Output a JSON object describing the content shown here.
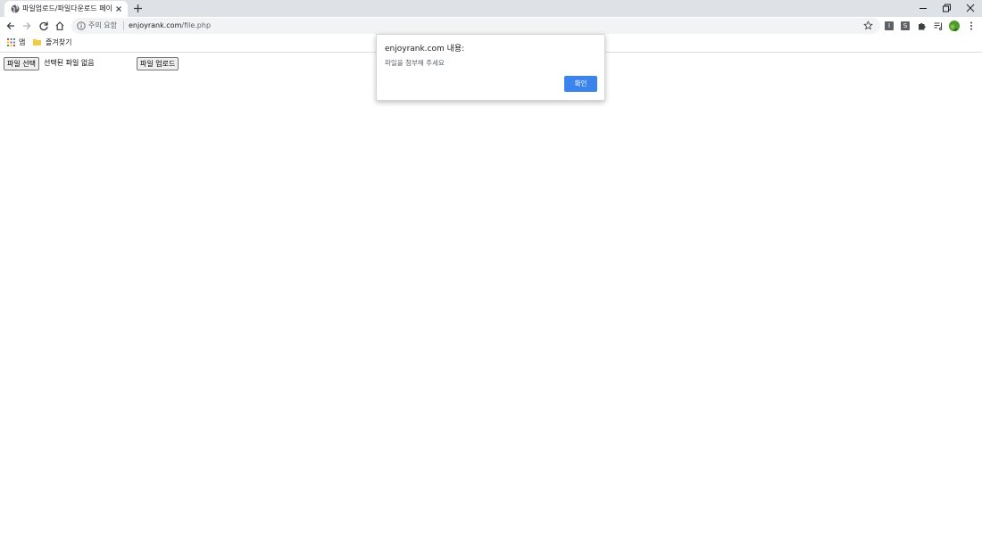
{
  "browser": {
    "tab": {
      "title": "파일업로드/파일다운로드 페이지"
    },
    "omnibox": {
      "security_label": "주의 요함",
      "url_host": "enjoyrank.com",
      "url_path": "/file.php"
    },
    "extensions": [
      {
        "label": "I"
      },
      {
        "label": "S"
      }
    ],
    "bookmarks": {
      "apps_label": "앱",
      "folder_label": "즐겨찾기"
    }
  },
  "page": {
    "file_input": {
      "button_label": "파일 선택",
      "status_text": "선택된 파일 없음"
    },
    "upload_button_label": "파일 업로드"
  },
  "dialog": {
    "title": "enjoyrank.com 내용:",
    "message": "파일을 첨부해 주세요",
    "ok_label": "확인"
  },
  "colors": {
    "tabstrip_bg": "#dee1e6",
    "omnibox_bg": "#f1f3f4",
    "dialog_button": "#3c84ed",
    "avatar": "#4f9a2a"
  }
}
